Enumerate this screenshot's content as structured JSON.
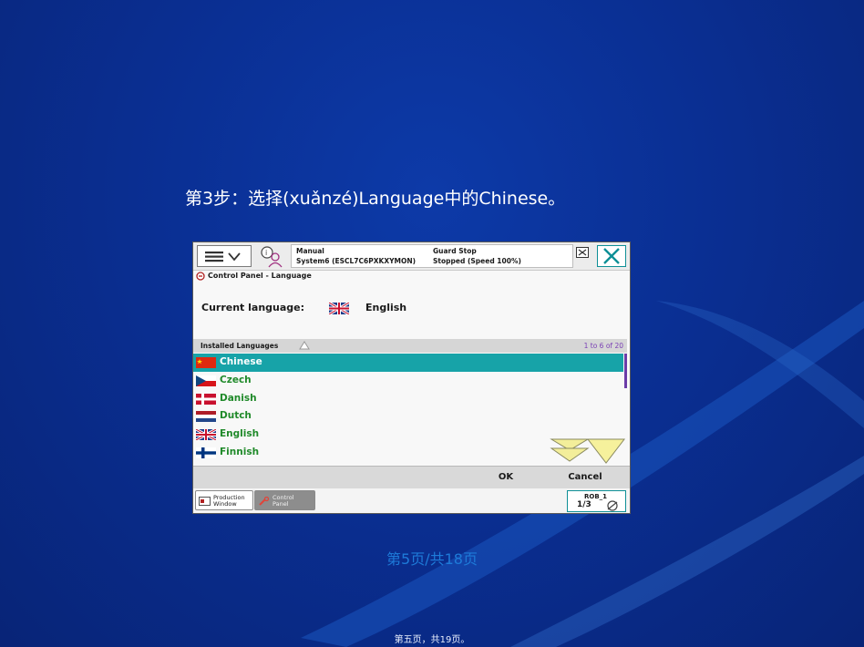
{
  "slide": {
    "step_title": "第3步：选择(xuǎnzé)Language中的Chinese。",
    "page_number": "第5页/共18页",
    "footer": "第五页，共19页。"
  },
  "window": {
    "status": {
      "mode": "Manual",
      "system": "System6 (ESCL7C6PXKXYMON)",
      "guard": "Guard Stop",
      "state": "Stopped (Speed 100%)"
    },
    "breadcrumb": "Control Panel - Language",
    "current_language_label": "Current language:",
    "current_language_value": "English",
    "list_header": "Installed Languages",
    "list_count": "1 to 6 of 20",
    "languages": [
      {
        "name": "Chinese",
        "flag": "cn-flag-icon",
        "selected": true
      },
      {
        "name": "Czech",
        "flag": "cz-flag-icon",
        "selected": false
      },
      {
        "name": "Danish",
        "flag": "dk-flag-icon",
        "selected": false
      },
      {
        "name": "Dutch",
        "flag": "nl-flag-icon",
        "selected": false
      },
      {
        "name": "English",
        "flag": "gb-flag-icon",
        "selected": false
      },
      {
        "name": "Finnish",
        "flag": "fi-flag-icon",
        "selected": false
      }
    ],
    "ok_label": "OK",
    "cancel_label": "Cancel",
    "taskbar": {
      "production_line1": "Production",
      "production_line2": "Window",
      "control_line1": "Control",
      "control_line2": "Panel",
      "rob_name": "ROB_1",
      "rob_fraction": "1/3"
    }
  },
  "colors": {
    "background": "#0a2f93",
    "selected_row": "#17a3a8",
    "language_text": "#208a2a",
    "accent": "#0e8f96",
    "page_number": "#1e7bd9"
  }
}
